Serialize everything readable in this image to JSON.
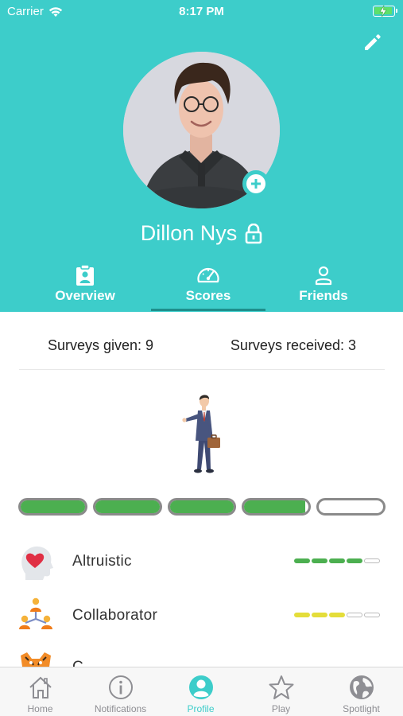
{
  "status_bar": {
    "carrier": "Carrier",
    "time": "8:17 PM"
  },
  "profile": {
    "name": "Dillon Nys"
  },
  "tabs": [
    {
      "label": "Overview",
      "icon": "clipboard-user-icon"
    },
    {
      "label": "Scores",
      "icon": "speedometer-icon",
      "active": true
    },
    {
      "label": "Friends",
      "icon": "person-icon"
    }
  ],
  "surveys": {
    "given_label": "Surveys given: 9",
    "received_label": "Surveys received: 3"
  },
  "progress": {
    "segments": [
      1,
      1,
      1,
      0.95,
      0
    ]
  },
  "traits": [
    {
      "label": "Altruistic",
      "icon": "heart-head-icon",
      "level": 4,
      "max": 5,
      "color": "#4caf50"
    },
    {
      "label": "Collaborator",
      "icon": "team-icon",
      "level": 3,
      "max": 5,
      "color": "#e4dd3a"
    },
    {
      "label": "C",
      "icon": "tiger-icon",
      "level": 0,
      "max": 5,
      "color": "#cccccc"
    }
  ],
  "tabbar": [
    {
      "label": "Home",
      "icon": "home-icon"
    },
    {
      "label": "Notifications",
      "icon": "info-icon"
    },
    {
      "label": "Profile",
      "icon": "profile-icon",
      "active": true
    },
    {
      "label": "Play",
      "icon": "star-icon"
    },
    {
      "label": "Spotlight",
      "icon": "globe-icon"
    }
  ],
  "colors": {
    "accent": "#3dcdca",
    "accent_dark": "#1e8f8c",
    "progress": "#4caf50",
    "inactive": "#8e8e93"
  }
}
